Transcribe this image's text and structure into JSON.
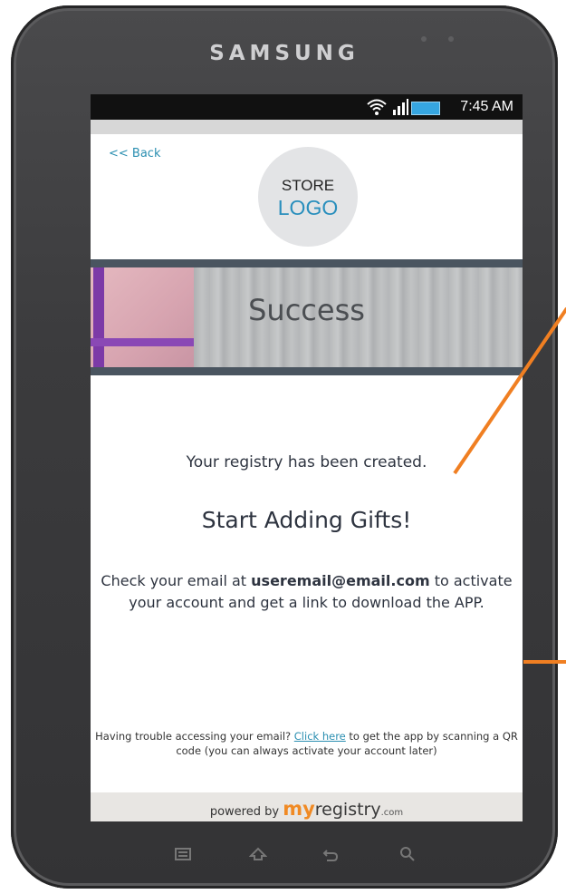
{
  "device": {
    "brand": "SAMSUNG"
  },
  "status": {
    "time": "7:45 AM"
  },
  "nav": {
    "back": "<< Back"
  },
  "logo": {
    "top": "STORE",
    "bottom": "LOGO"
  },
  "banner": {
    "title": "Success"
  },
  "content": {
    "created": "Your registry has been created.",
    "headline": "Start Adding Gifts!",
    "email_pre": "Check your email at ",
    "email": "useremail@email.com",
    "email_post": " to activate your account and get a link to download the APP."
  },
  "help": {
    "pre": "Having trouble accessing your email? ",
    "link": "Click here",
    "post": " to get the app by scanning a QR code (you can always activate your account later)"
  },
  "footer": {
    "powered": "powered by ",
    "my": "my",
    "registry": "registry",
    "com": ".com"
  },
  "colors": {
    "accent": "#2b8fb1",
    "orange": "#f07f22"
  }
}
